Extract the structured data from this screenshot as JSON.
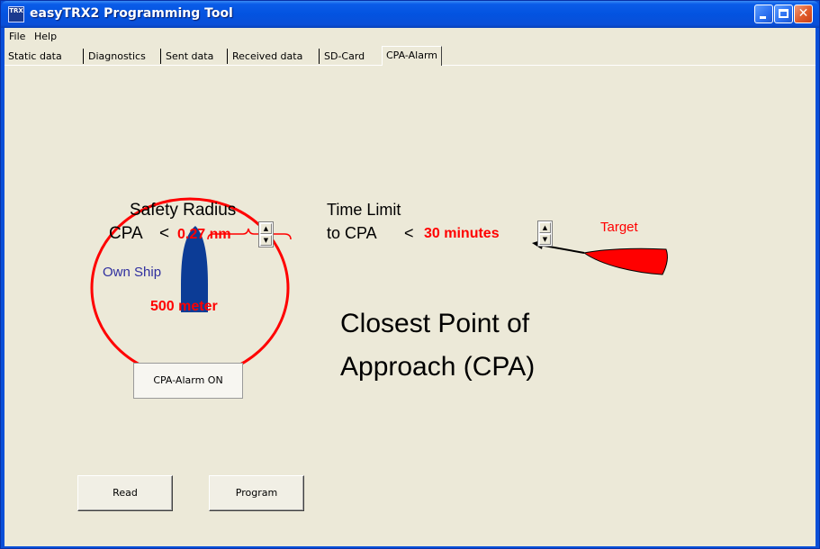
{
  "window": {
    "title": "easyTRX2 Programming Tool",
    "icon_label": "TRX"
  },
  "menu": {
    "items": [
      {
        "label": "File"
      },
      {
        "label": "Help"
      }
    ]
  },
  "tabs": [
    {
      "label": "Static data",
      "active": false
    },
    {
      "label": "Diagnostics",
      "active": false
    },
    {
      "label": "Sent data",
      "active": false
    },
    {
      "label": "Received data",
      "active": false
    },
    {
      "label": "SD-Card",
      "active": false
    },
    {
      "label": "CPA-Alarm",
      "active": true
    }
  ],
  "cpa": {
    "safety_radius_title": "Safety Radius",
    "cpa_prefix": "CPA",
    "lt": "<",
    "cpa_value": "0.27 nm",
    "meters_value": "500 meter",
    "own_ship_label": "Own Ship",
    "time_limit_title": "Time Limit",
    "to_cpa_prefix": "to CPA",
    "time_value": "30 minutes",
    "target_label": "Target",
    "heading_line1": "Closest Point of",
    "heading_line2": "Approach (CPA)",
    "alarm_button": "CPA-Alarm ON",
    "read_button": "Read",
    "program_button": "Program"
  },
  "colors": {
    "accent_red": "#ff0000",
    "own_ship_blue": "#0c3c96",
    "own_ship_label_blue": "#2f2f9f",
    "titlebar_blue": "#0a5ce8"
  },
  "icons": {
    "minimize": "minimize-icon",
    "maximize": "maximize-icon",
    "close": "close-icon",
    "spin_up": "arrow-up-icon",
    "spin_down": "arrow-down-icon"
  }
}
